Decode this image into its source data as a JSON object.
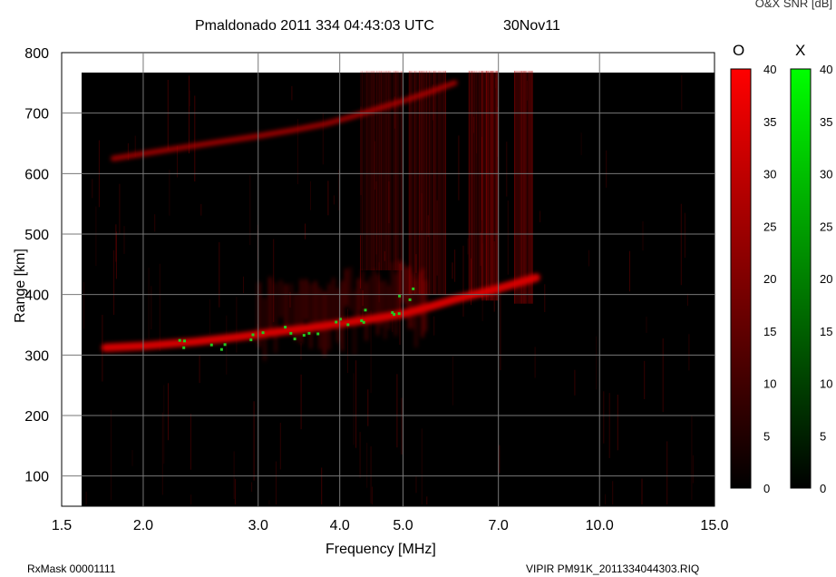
{
  "header": {
    "title": "Pmaldonado 2011 334 04:43:03 UTC",
    "date": "30Nov11",
    "colorbar_title": "O&X SNR [dB]"
  },
  "footer": {
    "left": "RxMask 00001111",
    "right": "VIPIR  PM91K_2011334044303.RIQ"
  },
  "chart_data": {
    "type": "heatmap",
    "title": "Pmaldonado 2011 334 04:43:03 UTC",
    "xlabel": "Frequency [MHz]",
    "ylabel": "Range [km]",
    "x_scale": "log",
    "xlim": [
      1.5,
      15.0
    ],
    "ylim": [
      50,
      800
    ],
    "x_ticks": [
      1.5,
      2.0,
      3.0,
      4.0,
      5.0,
      7.0,
      10.0,
      15.0
    ],
    "x_tick_labels": [
      "1.5",
      "2.0",
      "3.0",
      "4.0",
      "5.0",
      "7.0",
      "10.0",
      "15.0"
    ],
    "y_ticks": [
      100,
      200,
      300,
      400,
      500,
      600,
      700,
      800
    ],
    "y_tick_labels": [
      "100",
      "200",
      "300",
      "400",
      "500",
      "600",
      "700",
      "800"
    ],
    "grid": true,
    "colorbars": [
      {
        "name": "O",
        "color": "#ff0000",
        "range": [
          0,
          40
        ],
        "ticks": [
          0,
          5,
          10,
          15,
          20,
          25,
          30,
          35,
          40
        ]
      },
      {
        "name": "X",
        "color": "#00ff00",
        "range": [
          0,
          40
        ],
        "ticks": [
          0,
          5,
          10,
          15,
          20,
          25,
          30,
          35,
          40
        ]
      }
    ],
    "o_trace_lower": {
      "x": [
        1.75,
        2.0,
        2.4,
        2.8,
        3.2,
        3.6,
        4.0,
        4.5,
        5.0,
        5.5,
        6.0,
        7.0,
        8.0
      ],
      "y": [
        312,
        315,
        322,
        330,
        338,
        345,
        352,
        360,
        368,
        380,
        392,
        410,
        428
      ]
    },
    "o_trace_upper": {
      "x": [
        1.8,
        2.2,
        2.6,
        3.0,
        3.4,
        3.8,
        4.2,
        4.6,
        5.0,
        5.5,
        6.0
      ],
      "y": [
        625,
        640,
        652,
        662,
        672,
        682,
        695,
        708,
        720,
        735,
        750
      ]
    },
    "x_trace": {
      "x": [
        2.3,
        2.6,
        3.0,
        3.3,
        3.6,
        4.0,
        4.4,
        4.8,
        5.0
      ],
      "y": [
        318,
        322,
        330,
        338,
        345,
        355,
        365,
        380,
        400
      ]
    }
  }
}
